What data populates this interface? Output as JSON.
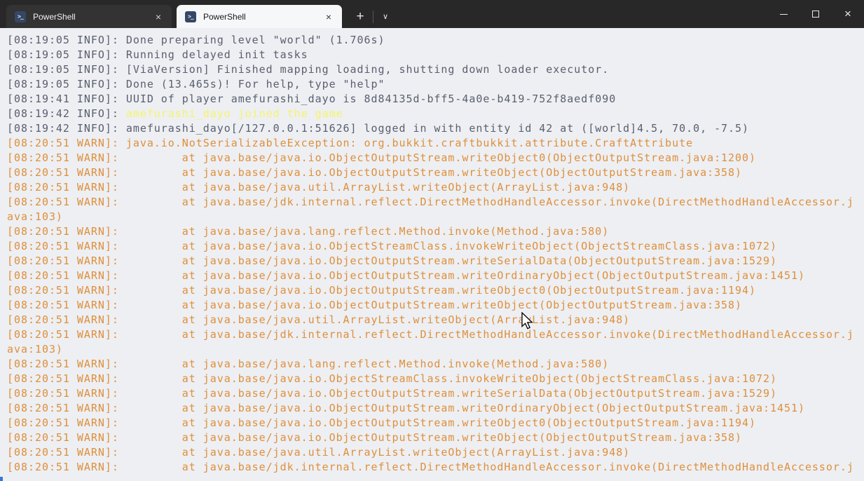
{
  "colors": {
    "bar_bg": "#282828",
    "tab_inactive_bg": "#333333",
    "tab_inactive_fg": "#f0f0f0",
    "tab_active_bg": "#f6f7f9",
    "tab_active_fg": "#191919",
    "ps_icon_bg": "#364765",
    "term_bg": "#edeff3",
    "info_fg": "#5a5f6d",
    "warn_fg": "#df8f3a",
    "yellow_fg": "#f7f465"
  },
  "window": {
    "tabs": [
      {
        "label": "PowerShell",
        "active": false
      },
      {
        "label": "PowerShell",
        "active": true
      }
    ],
    "icons": {
      "powershell_prompt": ">_",
      "tab_close": "×",
      "new_tab": "+",
      "dropdown": "∨",
      "maximize": "□",
      "close": "×"
    }
  },
  "terminal": {
    "lines": [
      {
        "segments": [
          {
            "text": "[08:19:05 INFO]: Done preparing level \"world\" (1.706s)",
            "color": "info"
          }
        ]
      },
      {
        "segments": [
          {
            "text": "[08:19:05 INFO]: Running delayed init tasks",
            "color": "info"
          }
        ]
      },
      {
        "segments": [
          {
            "text": "[08:19:05 INFO]: [ViaVersion] Finished mapping loading, shutting down loader executor.",
            "color": "info"
          }
        ]
      },
      {
        "segments": [
          {
            "text": "[08:19:05 INFO]: Done (13.465s)! For help, type \"help\"",
            "color": "info"
          }
        ]
      },
      {
        "segments": [
          {
            "text": "[08:19:41 INFO]: UUID of player amefurashi_dayo is 8d84135d-bff5-4a0e-b419-752f8aedf090",
            "color": "info"
          }
        ]
      },
      {
        "segments": [
          {
            "text": "[08:19:42 INFO]: ",
            "color": "info"
          },
          {
            "text": "amefurashi_dayo joined the game",
            "color": "yellow"
          }
        ]
      },
      {
        "segments": [
          {
            "text": "[08:19:42 INFO]: amefurashi_dayo[/127.0.0.1:51626] logged in with entity id 42 at ([world]4.5, 70.0, -7.5)",
            "color": "info"
          }
        ]
      },
      {
        "segments": [
          {
            "text": "[08:20:51 WARN]: java.io.NotSerializableException: org.bukkit.craftbukkit.attribute.CraftAttribute",
            "color": "warn"
          }
        ]
      },
      {
        "segments": [
          {
            "text": "[08:20:51 WARN]:         at java.base/java.io.ObjectOutputStream.writeObject0(ObjectOutputStream.java:1200)",
            "color": "warn"
          }
        ]
      },
      {
        "segments": [
          {
            "text": "[08:20:51 WARN]:         at java.base/java.io.ObjectOutputStream.writeObject(ObjectOutputStream.java:358)",
            "color": "warn"
          }
        ]
      },
      {
        "segments": [
          {
            "text": "[08:20:51 WARN]:         at java.base/java.util.ArrayList.writeObject(ArrayList.java:948)",
            "color": "warn"
          }
        ]
      },
      {
        "segments": [
          {
            "text": "[08:20:51 WARN]:         at java.base/jdk.internal.reflect.DirectMethodHandleAccessor.invoke(DirectMethodHandleAccessor.j",
            "color": "warn"
          }
        ]
      },
      {
        "segments": [
          {
            "text": "ava:103)",
            "color": "warn"
          }
        ]
      },
      {
        "segments": [
          {
            "text": "[08:20:51 WARN]:         at java.base/java.lang.reflect.Method.invoke(Method.java:580)",
            "color": "warn"
          }
        ]
      },
      {
        "segments": [
          {
            "text": "[08:20:51 WARN]:         at java.base/java.io.ObjectStreamClass.invokeWriteObject(ObjectStreamClass.java:1072)",
            "color": "warn"
          }
        ]
      },
      {
        "segments": [
          {
            "text": "[08:20:51 WARN]:         at java.base/java.io.ObjectOutputStream.writeSerialData(ObjectOutputStream.java:1529)",
            "color": "warn"
          }
        ]
      },
      {
        "segments": [
          {
            "text": "[08:20:51 WARN]:         at java.base/java.io.ObjectOutputStream.writeOrdinaryObject(ObjectOutputStream.java:1451)",
            "color": "warn"
          }
        ]
      },
      {
        "segments": [
          {
            "text": "[08:20:51 WARN]:         at java.base/java.io.ObjectOutputStream.writeObject0(ObjectOutputStream.java:1194)",
            "color": "warn"
          }
        ]
      },
      {
        "segments": [
          {
            "text": "[08:20:51 WARN]:         at java.base/java.io.ObjectOutputStream.writeObject(ObjectOutputStream.java:358)",
            "color": "warn"
          }
        ]
      },
      {
        "segments": [
          {
            "text": "[08:20:51 WARN]:         at java.base/java.util.ArrayList.writeObject(ArrayList.java:948)",
            "color": "warn"
          }
        ]
      },
      {
        "segments": [
          {
            "text": "[08:20:51 WARN]:         at java.base/jdk.internal.reflect.DirectMethodHandleAccessor.invoke(DirectMethodHandleAccessor.j",
            "color": "warn"
          }
        ]
      },
      {
        "segments": [
          {
            "text": "ava:103)",
            "color": "warn"
          }
        ]
      },
      {
        "segments": [
          {
            "text": "[08:20:51 WARN]:         at java.base/java.lang.reflect.Method.invoke(Method.java:580)",
            "color": "warn"
          }
        ]
      },
      {
        "segments": [
          {
            "text": "[08:20:51 WARN]:         at java.base/java.io.ObjectStreamClass.invokeWriteObject(ObjectStreamClass.java:1072)",
            "color": "warn"
          }
        ]
      },
      {
        "segments": [
          {
            "text": "[08:20:51 WARN]:         at java.base/java.io.ObjectOutputStream.writeSerialData(ObjectOutputStream.java:1529)",
            "color": "warn"
          }
        ]
      },
      {
        "segments": [
          {
            "text": "[08:20:51 WARN]:         at java.base/java.io.ObjectOutputStream.writeOrdinaryObject(ObjectOutputStream.java:1451)",
            "color": "warn"
          }
        ]
      },
      {
        "segments": [
          {
            "text": "[08:20:51 WARN]:         at java.base/java.io.ObjectOutputStream.writeObject0(ObjectOutputStream.java:1194)",
            "color": "warn"
          }
        ]
      },
      {
        "segments": [
          {
            "text": "[08:20:51 WARN]:         at java.base/java.io.ObjectOutputStream.writeObject(ObjectOutputStream.java:358)",
            "color": "warn"
          }
        ]
      },
      {
        "segments": [
          {
            "text": "[08:20:51 WARN]:         at java.base/java.util.ArrayList.writeObject(ArrayList.java:948)",
            "color": "warn"
          }
        ]
      },
      {
        "segments": [
          {
            "text": "[08:20:51 WARN]:         at java.base/jdk.internal.reflect.DirectMethodHandleAccessor.invoke(DirectMethodHandleAccessor.j",
            "color": "warn"
          }
        ]
      }
    ]
  }
}
